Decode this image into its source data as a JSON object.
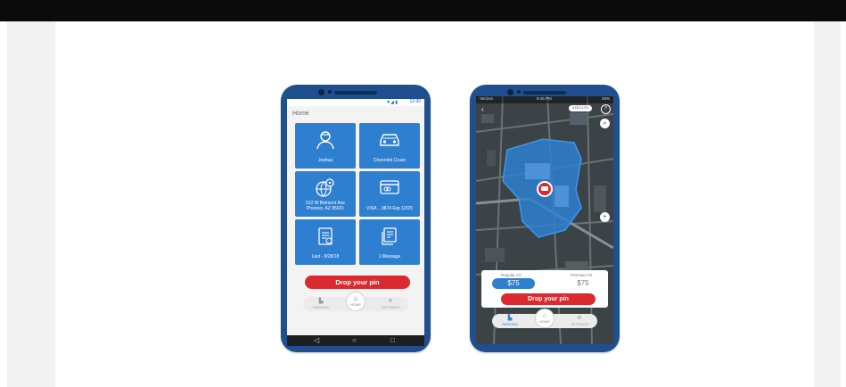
{
  "phone1": {
    "status_time": "12:30",
    "status_icons": "▼◢ ▮",
    "title": "Home",
    "tiles": [
      {
        "label": "Joshua",
        "icon": "person-icon"
      },
      {
        "label": "Chevrolet Cruze",
        "icon": "car-icon"
      },
      {
        "label": "512 W Belmont Ave Phoenix, AZ 85021",
        "icon": "globe-pin-icon"
      },
      {
        "label": "VISA ...3874 Exp 12/25",
        "icon": "credit-card-icon"
      },
      {
        "label": "Last - 8/28/18",
        "icon": "receipt-icon"
      },
      {
        "label": "1 Message",
        "icon": "message-icon"
      }
    ],
    "drop_pin": "Drop your pin",
    "nav": {
      "left": "PARKING",
      "center": "HOME",
      "right": "SETTINGS"
    },
    "system_nav": {
      "back": "◁",
      "home": "○",
      "recent": "□"
    }
  },
  "phone2": {
    "status_left": "Verizon",
    "status_time": "8:45 PM",
    "status_right": "25%",
    "map_toggle": "SATELLITE",
    "zoom": "+",
    "prices": [
      {
        "label": "Regular Air",
        "value": "$75"
      },
      {
        "label": "Premium Air",
        "value": "$75"
      }
    ],
    "drop_pin": "Drop your pin",
    "nav": {
      "left": "PARKING",
      "center": "HOME",
      "right": "SETTINGS"
    }
  },
  "colors": {
    "primary": "#2f7fd0",
    "accent": "#d92b2f",
    "phone_body": "#1f4f8f"
  }
}
